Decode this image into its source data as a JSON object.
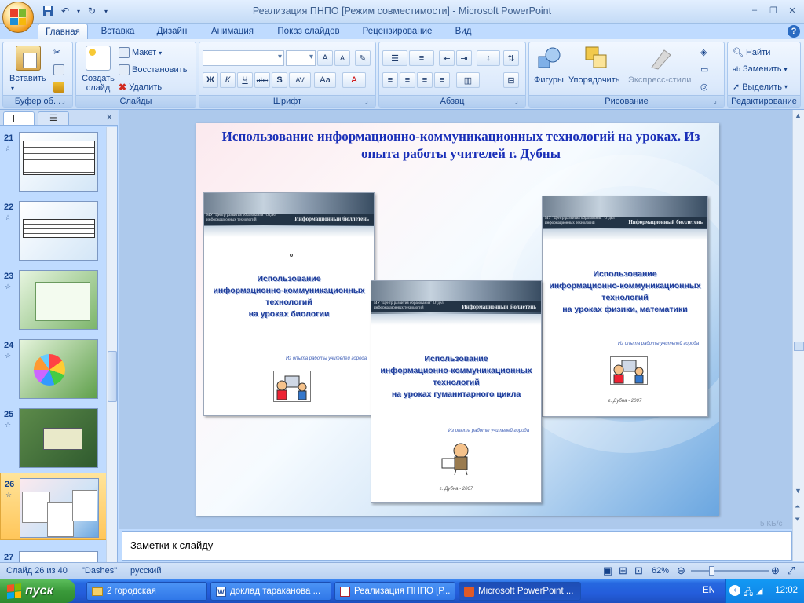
{
  "window": {
    "title": "Реализация ПНПО [Режим совместимости] - Microsoft PowerPoint"
  },
  "ribbon_tabs": [
    "Главная",
    "Вставка",
    "Дизайн",
    "Анимация",
    "Показ слайдов",
    "Рецензирование",
    "Вид"
  ],
  "ribbon": {
    "clipboard": {
      "paste": "Вставить",
      "label": "Буфер об..."
    },
    "slides": {
      "new_slide": "Создать слайд",
      "layout": "Макет",
      "reset": "Восстановить",
      "delete": "Удалить",
      "label": "Слайды"
    },
    "font": {
      "label": "Шрифт",
      "bold": "Ж",
      "italic": "К",
      "underline": "Ч",
      "strike": "abc",
      "shadow": "S",
      "spacing": "AV",
      "case": "Aa",
      "color": "A",
      "grow": "A",
      "shrink": "A"
    },
    "paragraph": {
      "label": "Абзац"
    },
    "drawing": {
      "shapes": "Фигуры",
      "arrange": "Упорядочить",
      "styles": "Экспресс-стили",
      "label": "Рисование"
    },
    "editing": {
      "find": "Найти",
      "replace": "Заменить",
      "select": "Выделить",
      "label": "Редактирование"
    }
  },
  "thumbnails": [
    {
      "num": "21"
    },
    {
      "num": "22"
    },
    {
      "num": "23"
    },
    {
      "num": "24"
    },
    {
      "num": "25"
    },
    {
      "num": "26",
      "selected": true
    },
    {
      "num": "27"
    }
  ],
  "slide": {
    "title": "Использование информационно-коммуникационных технологий на уроках. Из опыта работы учителей г. Дубны",
    "bulletins": [
      {
        "header": "Информационный бюллетень",
        "org": "МУ \"Центр развития образования\" Отдел информационных технологий",
        "title_lines": [
          "Использование",
          "информационно-коммуникационных",
          "технологий",
          "на уроках биологии"
        ],
        "sub": "Из опыта работы учителей города"
      },
      {
        "header": "Информационный бюллетень",
        "org": "МУ \"Центр развития образования\" Отдел информационных технологий",
        "title_lines": [
          "Использование",
          "информационно-коммуникационных",
          "технологий",
          "на уроках гуманитарного цикла"
        ],
        "sub": "Из опыта работы учителей города",
        "foot": "г. Дубна - 2007"
      },
      {
        "header": "Информационный бюллетень",
        "org": "МУ \"Центр развития образования\" Отдел информационных технологий",
        "title_lines": [
          "Использование",
          "информационно-коммуникационных",
          "технологий",
          "на уроках физики, математики"
        ],
        "sub": "Из опыта работы учителей города",
        "foot": "г. Дубна - 2007"
      }
    ]
  },
  "notes": {
    "placeholder": "Заметки к слайду"
  },
  "kb_badge": "5 КБ/с",
  "status": {
    "slide_of": "Слайд 26 из 40",
    "theme": "\"Dashes\"",
    "language": "русский",
    "zoom": "62%"
  },
  "taskbar": {
    "start": "пуск",
    "tasks": [
      "2 городская",
      "доклад тараканова ...",
      "Реализация ПНПО [Р...",
      "Microsoft PowerPoint ..."
    ],
    "lang": "EN",
    "time": "12:02"
  },
  "colors": {
    "ribbon_text": "#15428b",
    "slide_title": "#1a2fb8",
    "taskbar": "#245ddb",
    "start": "#3a9a3a"
  }
}
